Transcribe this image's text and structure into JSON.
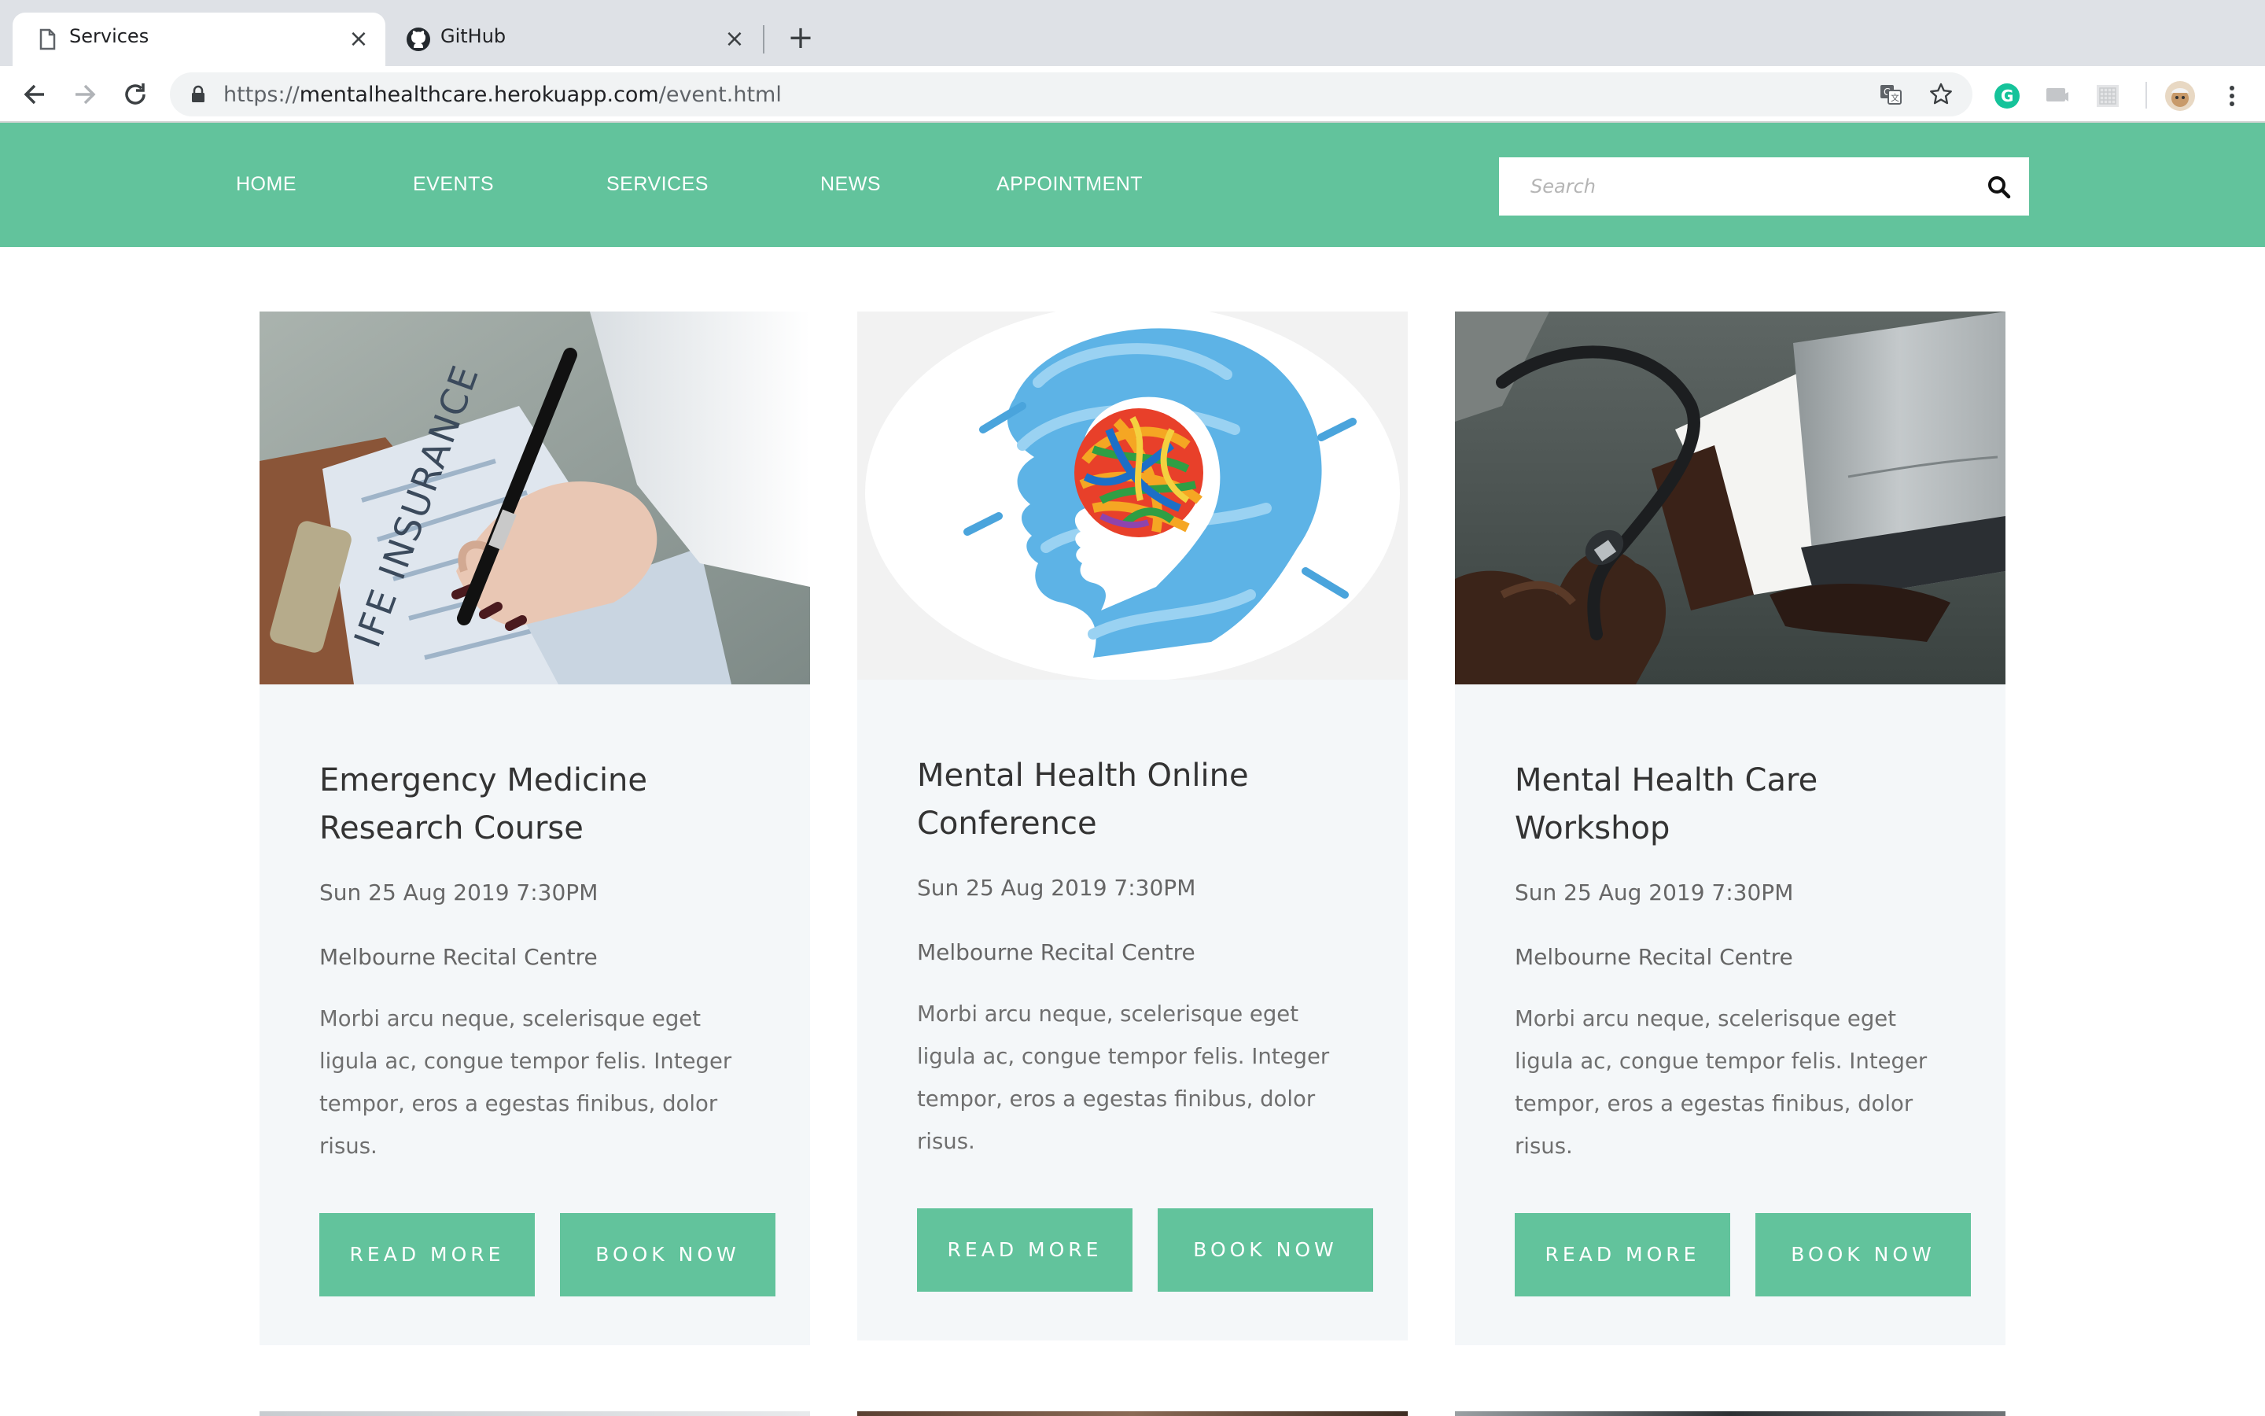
{
  "browser": {
    "tabs": [
      {
        "title": "Services",
        "icon": "page-icon",
        "active": true
      },
      {
        "title": "GitHub",
        "icon": "github-icon",
        "active": false
      }
    ],
    "url": {
      "scheme": "https://",
      "host": "mentalhealthcare.herokuapp.com",
      "path": "/event.html"
    }
  },
  "nav": {
    "links": [
      "HOME",
      "EVENTS",
      "SERVICES",
      "NEWS",
      "APPOINTMENT"
    ],
    "search_placeholder": "Search"
  },
  "events": [
    {
      "title": "Emergency Medicine Research Course",
      "date": "Sun 25 Aug 2019 7:30PM",
      "venue": "Melbourne Recital Centre",
      "description": "Morbi arcu neque, scelerisque eget ligula ac, congue tempor felis. Integer tempor, eros a egestas finibus, dolor risus.",
      "read_more": "READ MORE",
      "book_now": "BOOK NOW",
      "image": "insurance-form-writing-photo"
    },
    {
      "title": "Mental Health Online Conference",
      "date": "Sun 25 Aug 2019 7:30PM",
      "venue": "Melbourne Recital Centre",
      "description": "Morbi arcu neque, scelerisque eget ligula ac, congue tempor felis. Integer tempor, eros a egestas finibus, dolor risus.",
      "read_more": "READ MORE",
      "book_now": "BOOK NOW",
      "image": "head-silhouette-brain-illustration"
    },
    {
      "title": "Mental Health Care Workshop",
      "date": "Sun 25 Aug 2019 7:30PM",
      "venue": "Melbourne Recital Centre",
      "description": "Morbi arcu neque, scelerisque eget ligula ac, congue tempor felis. Integer tempor, eros a egestas finibus, dolor risus.",
      "read_more": "READ MORE",
      "book_now": "BOOK NOW",
      "image": "blood-pressure-cuff-photo"
    }
  ],
  "colors": {
    "brand": "#62c39c",
    "card_bg": "#f4f7f9",
    "title": "#333333",
    "body_text": "#6f6f6f"
  }
}
